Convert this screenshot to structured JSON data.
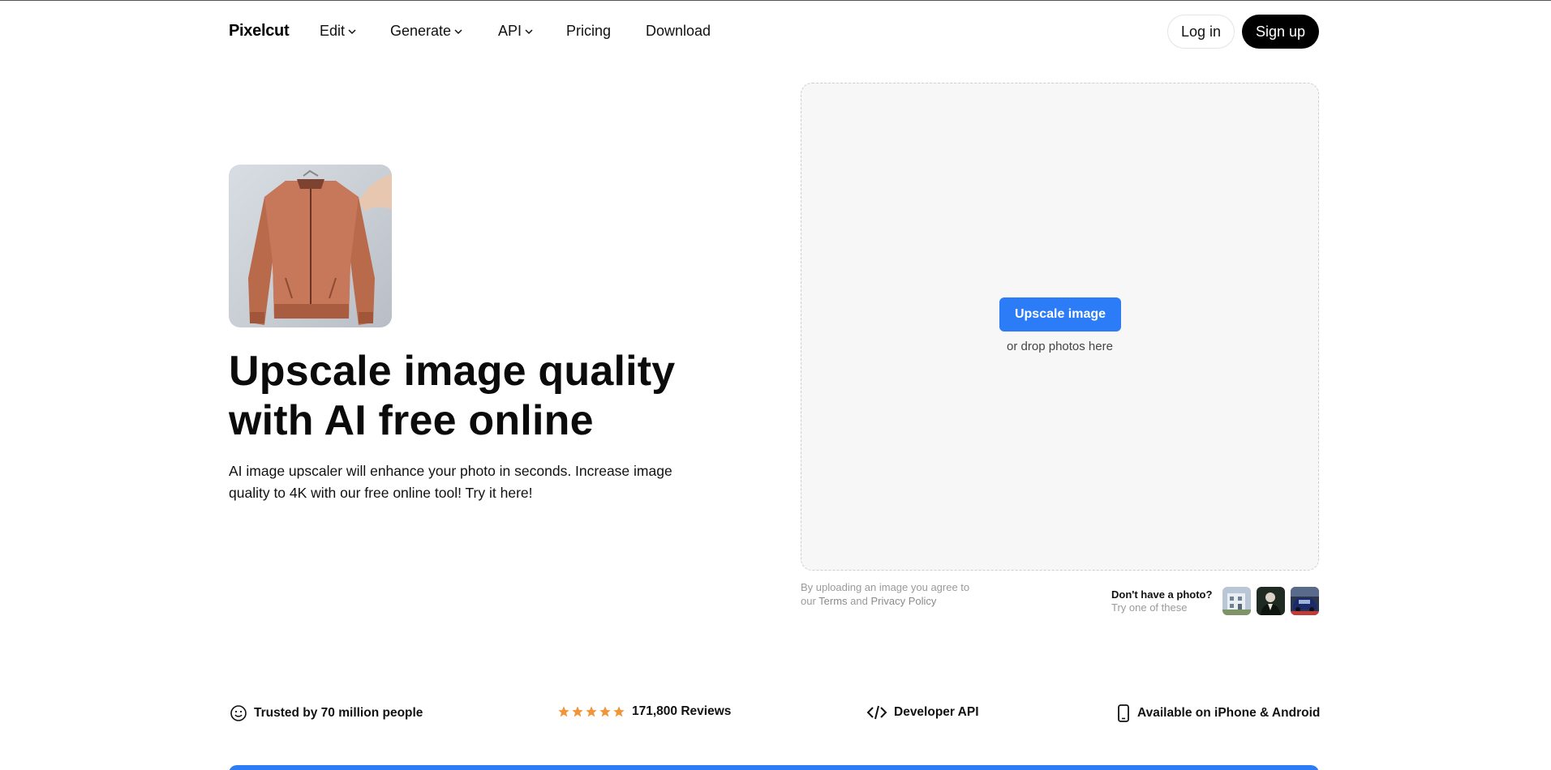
{
  "nav": {
    "logo": "Pixelcut",
    "items": [
      {
        "label": "Edit",
        "has_menu": true
      },
      {
        "label": "Generate",
        "has_menu": true
      },
      {
        "label": "API",
        "has_menu": true
      },
      {
        "label": "Pricing",
        "has_menu": false
      },
      {
        "label": "Download",
        "has_menu": false
      }
    ],
    "login_label": "Log in",
    "signup_label": "Sign up"
  },
  "hero": {
    "title_line1": "Upscale image quality",
    "title_line2": "with AI free online",
    "description": "AI image upscaler will enhance your photo in seconds. Increase image quality to 4K with our free online tool! Try it here!"
  },
  "upload": {
    "button_label": "Upscale image",
    "drop_hint": "or drop photos here",
    "legal_prefix": "By uploading an image you agree to our ",
    "legal_terms": "Terms",
    "legal_and": " and ",
    "legal_privacy": "Privacy Policy",
    "sample_title": "Don't have a photo?",
    "sample_subtitle": "Try one of these",
    "sample_icons": [
      "building-thumbnail",
      "portrait-thumbnail",
      "car-thumbnail"
    ]
  },
  "stats": {
    "trusted": "Trusted by 70 million people",
    "reviews": "171,800 Reviews",
    "rating_stars": 5,
    "api": "Developer API",
    "platforms": "Available on iPhone & Android"
  },
  "colors": {
    "accent": "#2b7cf6",
    "star": "#f0953a",
    "signup_bg": "#000000",
    "dropzone_bg": "#f7f7f7"
  }
}
